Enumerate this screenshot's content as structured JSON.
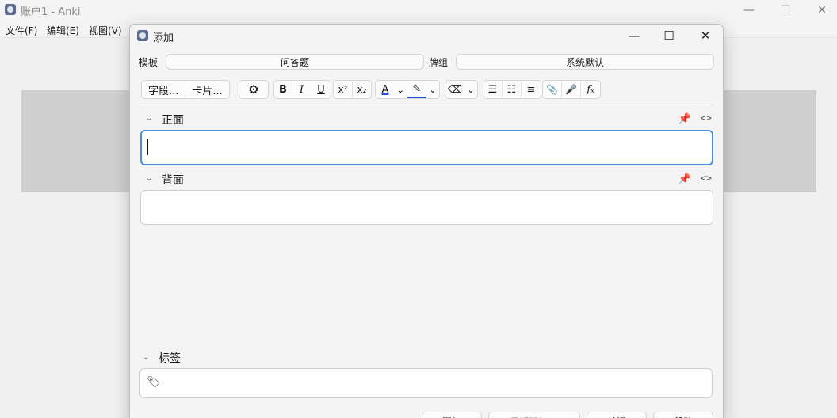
{
  "main_window": {
    "title": "账户1 - Anki",
    "menu": [
      "文件(F)",
      "编辑(E)",
      "视图(V)"
    ],
    "controls": {
      "minimize": "—",
      "maximize": "☐",
      "close": "✕"
    }
  },
  "dialog": {
    "title": "添加",
    "controls": {
      "minimize": "—",
      "maximize": "☐",
      "close": "✕"
    },
    "notetype_label": "模板",
    "notetype_value": "问答题",
    "deck_label": "牌组",
    "deck_value": "系统默认",
    "toolbar": {
      "fields_button": "字段...",
      "cards_button": "卡片...",
      "settings_icon": "⚙",
      "bold": "B",
      "italic": "I",
      "underline": "U",
      "superscript": "x²",
      "subscript": "x₂",
      "text_color": "A",
      "dropdown": "⌄",
      "highlight": "✎",
      "eraser": "⌫",
      "bullet_list": "☰",
      "ordered_list": "☷",
      "align": "≡",
      "attach": "📎",
      "record": "🎤",
      "math": "fₓ",
      "text_color_hex": "#2b4fd6",
      "highlight_hex": "#2b4fd6"
    },
    "fields": [
      {
        "name": "正面",
        "value": ""
      },
      {
        "name": "背面",
        "value": ""
      }
    ],
    "field_icons": {
      "collapse": "⌄",
      "pin": "📌",
      "html": "<>"
    },
    "tags_label": "标签",
    "tag_icon": "🏷",
    "buttons": {
      "add": "添加",
      "history": "最近添加 ▼",
      "close": "关闭",
      "help": "帮助"
    }
  }
}
